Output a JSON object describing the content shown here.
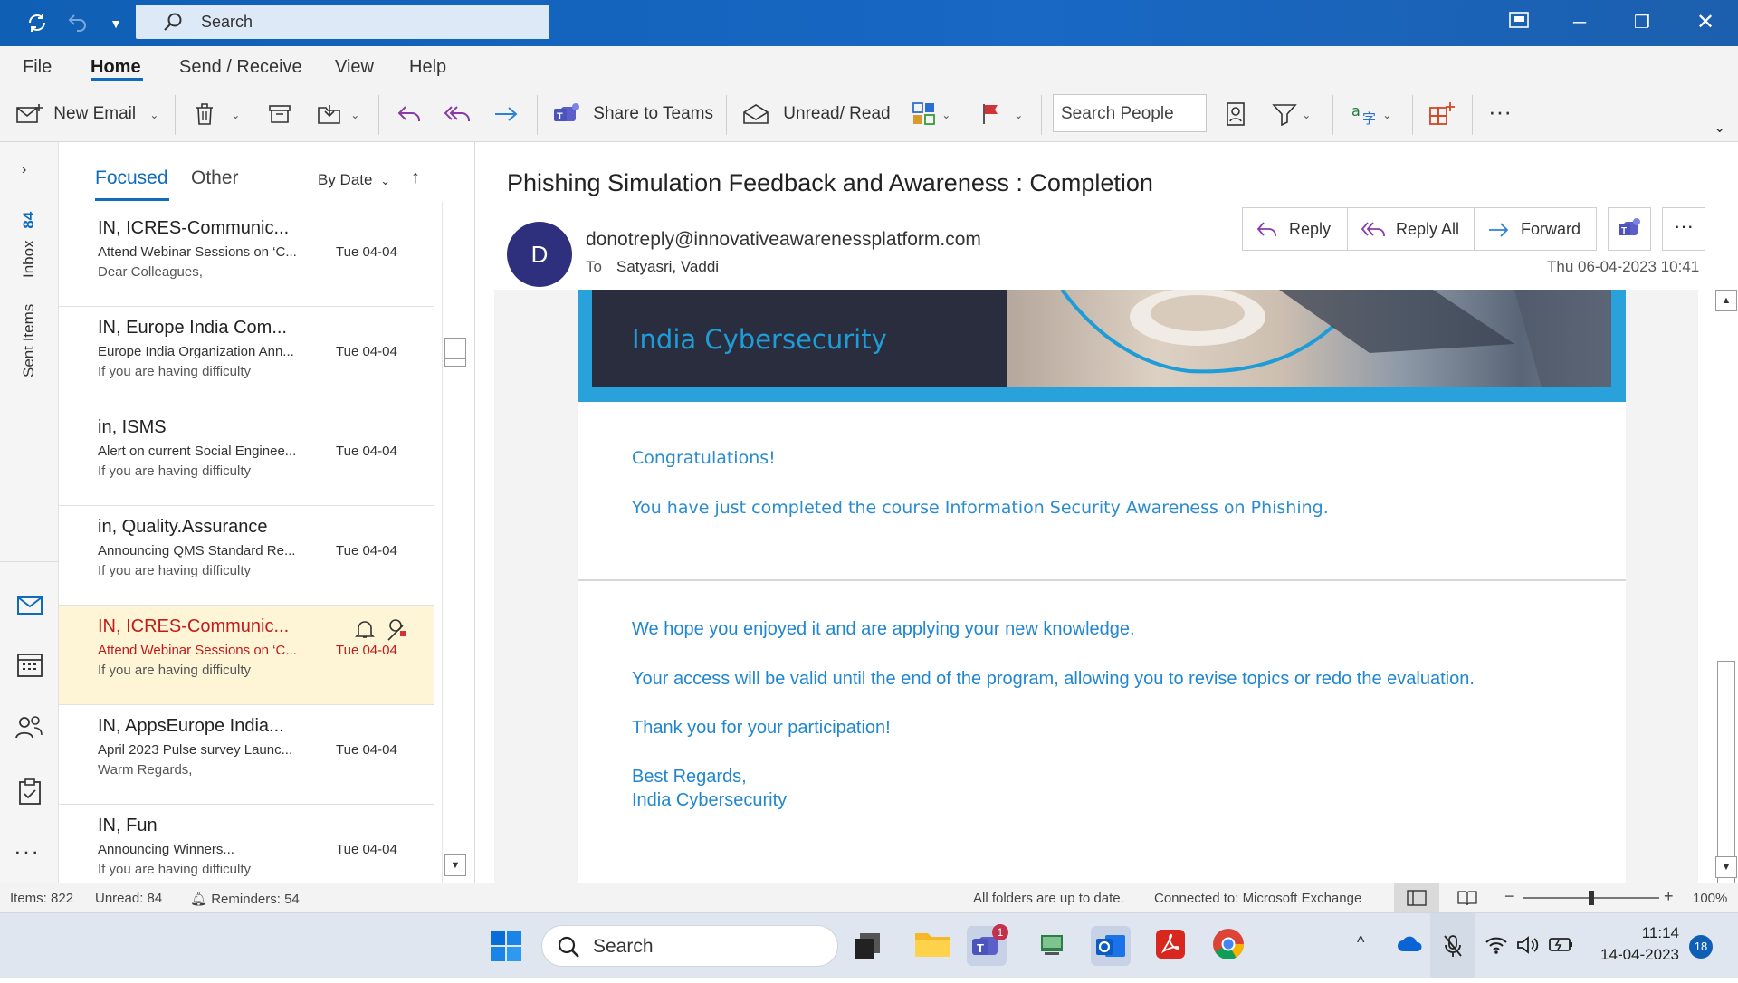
{
  "titlebar": {
    "search_placeholder": "Search"
  },
  "menu": {
    "file": "File",
    "home": "Home",
    "send_receive": "Send / Receive",
    "view": "View",
    "help": "Help"
  },
  "ribbon": {
    "new_email": "New Email",
    "share_to_teams": "Share to Teams",
    "unread_read": "Unread/ Read",
    "search_people": "Search People"
  },
  "rail": {
    "inbox_label": "Inbox",
    "inbox_count": "84",
    "sent_items": "Sent Items"
  },
  "list": {
    "tab_focused": "Focused",
    "tab_other": "Other",
    "sort": "By Date",
    "messages": [
      {
        "sender": "IN, ICRES-Communic...",
        "subject": "Attend Webinar Sessions on ‘C...",
        "preview": "Dear Colleagues,",
        "date": "Tue 04-04"
      },
      {
        "sender": "IN, Europe India Com...",
        "subject": "Europe India Organization Ann...",
        "preview": "If you are having difficulty",
        "date": "Tue 04-04"
      },
      {
        "sender": "in, ISMS",
        "subject": "Alert on current Social Enginee...",
        "preview": "If you are having difficulty",
        "date": "Tue 04-04"
      },
      {
        "sender": "in, Quality.Assurance",
        "subject": "Announcing QMS Standard Re...",
        "preview": "If you are having difficulty",
        "date": "Tue 04-04"
      },
      {
        "sender": "IN, ICRES-Communic...",
        "subject": "Attend Webinar Sessions on ‘C...",
        "preview": "If you are having difficulty",
        "date": "Tue 04-04"
      },
      {
        "sender": "IN, AppsEurope India...",
        "subject": "April 2023 Pulse survey Launc...",
        "preview": " Warm Regards,",
        "date": "Tue 04-04"
      },
      {
        "sender": "IN, Fun",
        "subject": "Announcing Winners...",
        "preview": "If you are having difficulty",
        "date": "Tue 04-04"
      }
    ]
  },
  "reading": {
    "subject": "Phishing Simulation Feedback and Awareness : Completion",
    "avatar_letter": "D",
    "from": "donotreply@innovativeawarenessplatform.com",
    "to_label": "To",
    "to": "Satyasri, Vaddi",
    "date": "Thu 06-04-2023 10:41",
    "reply": "Reply",
    "reply_all": "Reply All",
    "forward": "Forward",
    "body": {
      "banner_title": "India Cybersecurity",
      "congrats": "Congratulations!",
      "completed": "You have just completed the course Information Security Awareness on Phishing.",
      "hope": "We hope you enjoyed it and are applying your new knowledge.",
      "access": "Your access will be valid until the end of the program, allowing you to revise topics or redo the evaluation.",
      "thanks": "Thank you for your participation!",
      "regards": "Best Regards,",
      "signature": "India Cybersecurity"
    }
  },
  "status": {
    "items": "Items: 822",
    "unread": "Unread: 84",
    "reminders": "Reminders: 54",
    "folders": "All folders are up to date.",
    "connected": "Connected to: Microsoft Exchange",
    "zoom": "100%",
    "zoom_level": 0.5
  },
  "taskbar": {
    "search": "Search",
    "teams_badge": "1",
    "time": "11:14",
    "date": "14-04-2023",
    "notif_count": "18"
  },
  "colors": {
    "accent": "#0f6cbd",
    "titlebar": "#1565c0",
    "selected_row": "#fdf5d6",
    "selected_text": "#c41a1a",
    "body_text": "#1f86d0"
  }
}
